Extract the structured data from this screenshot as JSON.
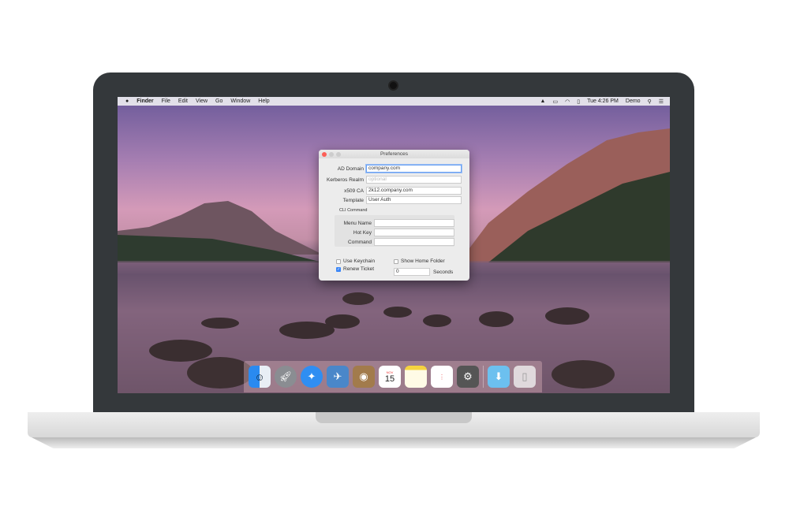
{
  "menubar": {
    "apple": "",
    "app": "Finder",
    "items": [
      "File",
      "Edit",
      "View",
      "Go",
      "Window",
      "Help"
    ],
    "clock": "Tue 4:26 PM",
    "user": "Demo"
  },
  "dialog": {
    "title": "Preferences",
    "ad_domain": {
      "label": "AD Domain",
      "value": "company.com"
    },
    "kerberos": {
      "label": "Kerberos Realm",
      "placeholder": "optional"
    },
    "x509": {
      "label": "x509 CA",
      "value": "2k12.company.com"
    },
    "template": {
      "label": "Template",
      "value": "User Auth"
    },
    "cli_title": "CLI Command",
    "menu_name": {
      "label": "Menu Name",
      "value": ""
    },
    "hot_key": {
      "label": "Hot Key",
      "value": ""
    },
    "command": {
      "label": "Command",
      "value": ""
    },
    "use_keychain": {
      "label": "Use Keychain",
      "checked": false
    },
    "show_home": {
      "label": "Show Home Folder",
      "checked": false
    },
    "renew_ticket": {
      "label": "Renew Ticket",
      "checked": true
    },
    "seconds": {
      "value": "0",
      "label": "Seconds"
    }
  },
  "dock": {
    "items": [
      "finder",
      "launchpad",
      "safari",
      "preview",
      "contacts",
      "calendar",
      "notes",
      "reminders",
      "system-preferences",
      "downloads",
      "trash"
    ],
    "calendar_month": "NOV",
    "calendar_day": "15"
  }
}
